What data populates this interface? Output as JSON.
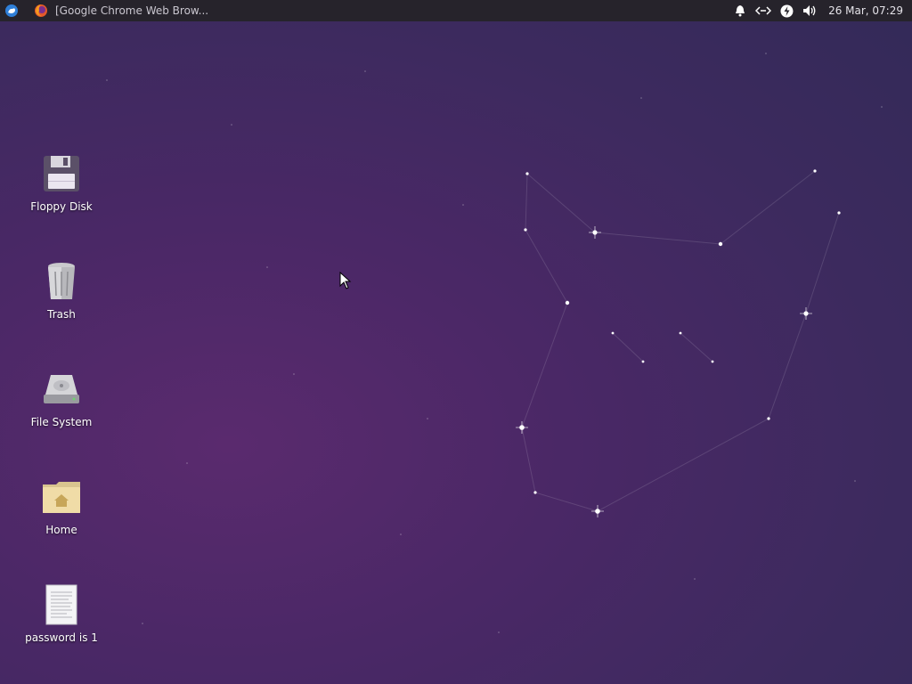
{
  "panel": {
    "taskbar_title": "[Google Chrome Web Brow...",
    "clock": "26 Mar, 07:29",
    "icons": [
      "whisker-menu-icon",
      "firefox-icon",
      "bell-icon",
      "network-icon",
      "power-icon",
      "volume-icon"
    ]
  },
  "desktop": {
    "icons": [
      {
        "label": "Floppy Disk",
        "icon": "floppy-disk-icon"
      },
      {
        "label": "Trash",
        "icon": "trash-icon"
      },
      {
        "label": "File System",
        "icon": "hard-drive-icon"
      },
      {
        "label": "Home",
        "icon": "home-folder-icon"
      },
      {
        "label": "password is 1",
        "icon": "text-file-icon"
      }
    ]
  },
  "colors": {
    "panel_bg": "#26232b",
    "wallpaper": "#4a2866"
  }
}
